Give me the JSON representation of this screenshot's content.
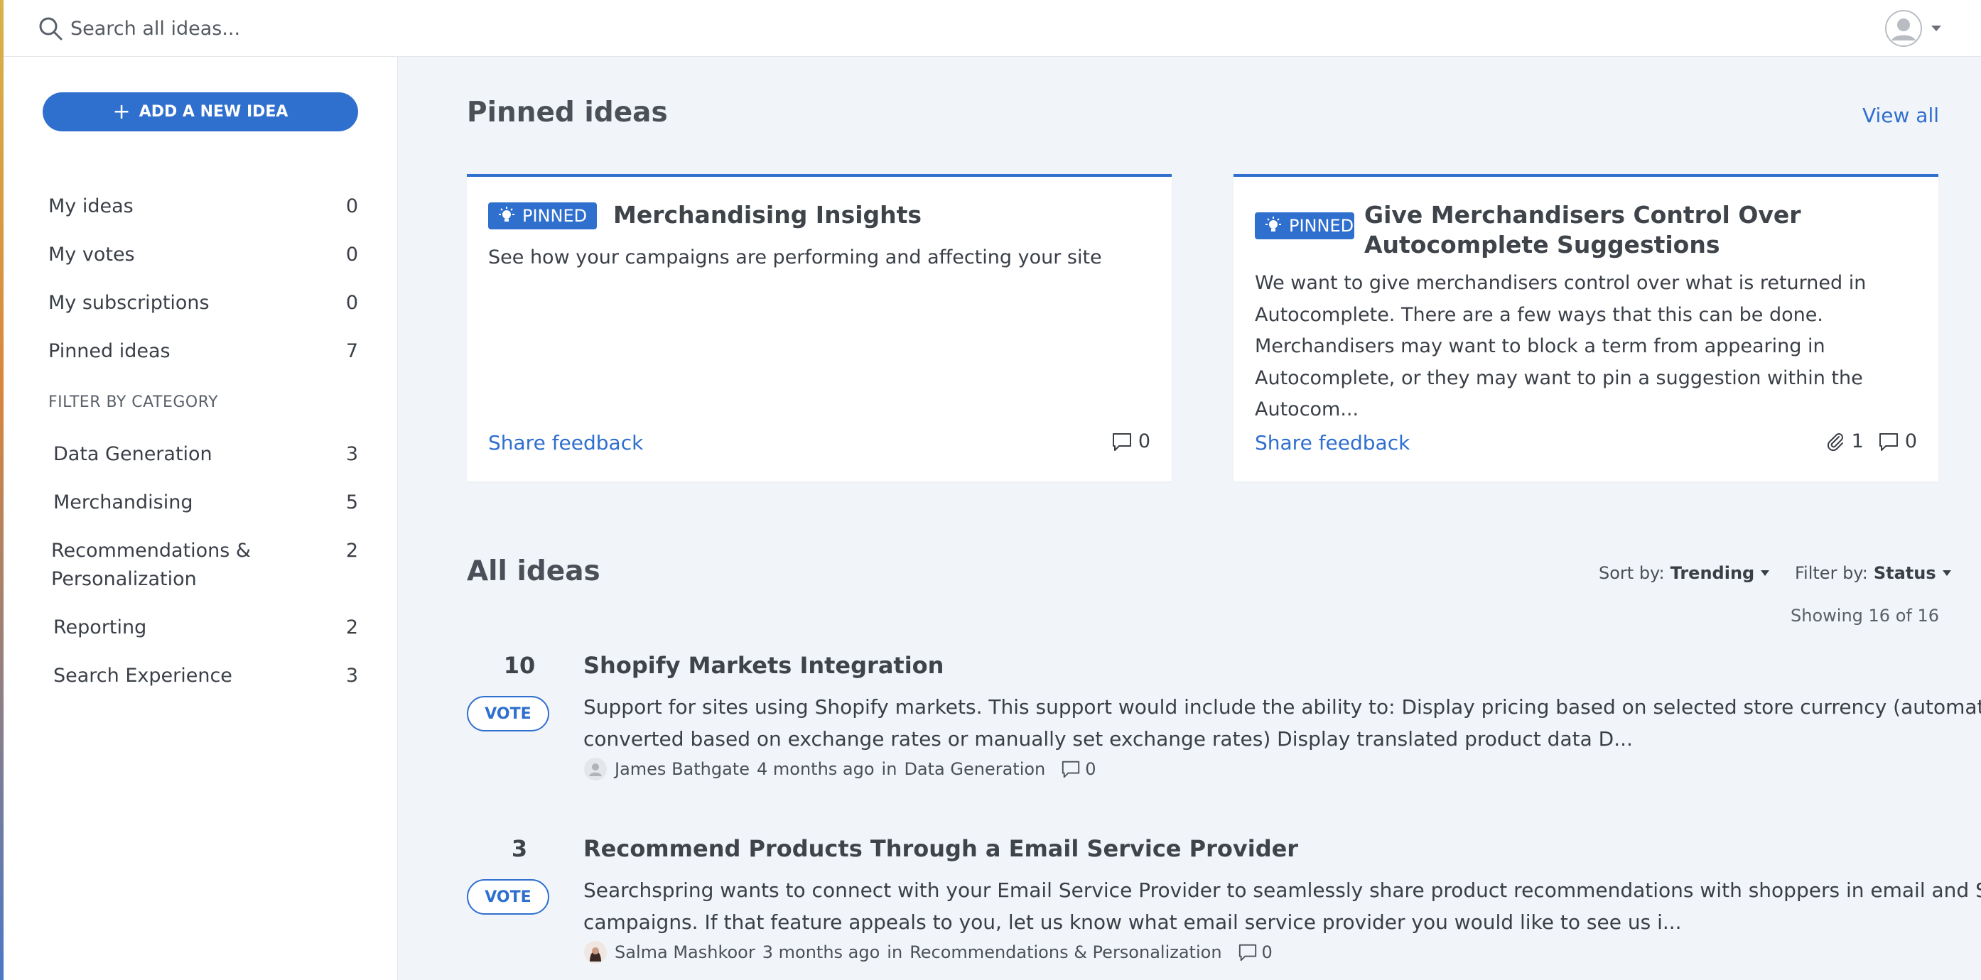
{
  "search": {
    "placeholder": "Search all ideas..."
  },
  "sidebar": {
    "add_button_label": "ADD A NEW IDEA",
    "nav": [
      {
        "label": "My ideas",
        "count": "0"
      },
      {
        "label": "My votes",
        "count": "0"
      },
      {
        "label": "My subscriptions",
        "count": "0"
      },
      {
        "label": "Pinned ideas",
        "count": "7"
      }
    ],
    "filter_heading": "FILTER BY CATEGORY",
    "categories": [
      {
        "label": "Data Generation",
        "count": "3"
      },
      {
        "label": "Merchandising",
        "count": "5"
      },
      {
        "label": "Recommendations & Personalization",
        "count": "2"
      },
      {
        "label": "Reporting",
        "count": "2"
      },
      {
        "label": "Search Experience",
        "count": "3"
      }
    ]
  },
  "pinned": {
    "title": "Pinned ideas",
    "view_all": "View all",
    "badge": "PINNED",
    "cards": [
      {
        "title": "Merchandising Insights",
        "description": "See how your campaigns are performing and affecting your site",
        "share": "Share feedback",
        "comments": "0"
      },
      {
        "title": "Give Merchandisers Control Over Autocomplete Suggestions",
        "description": "We want to give merchandisers control over what is returned in Autocomplete. There are a few ways that this can be done. Merchandisers may want to block a term from appearing in Autocomplete, or they may want to pin a suggestion within the Autocom...",
        "share": "Share feedback",
        "attachments": "1",
        "comments": "0"
      }
    ]
  },
  "all_ideas": {
    "title": "All ideas",
    "sort_label": "Sort by:",
    "sort_value": "Trending",
    "filter_label": "Filter by:",
    "filter_value": "Status",
    "showing": "Showing 16 of 16",
    "vote_label": "VOTE",
    "items": [
      {
        "votes": "10",
        "title": "Shopify Markets Integration",
        "description": "Support for sites using Shopify markets. This support would include the ability to: Display pricing based on selected store currency (automatically converted based on exchange rates or manually set exchange rates) Display translated product data D...",
        "author": "James Bathgate",
        "time": "4 months ago",
        "in": "in",
        "category": "Data Generation",
        "comments": "0"
      },
      {
        "votes": "3",
        "title": "Recommend Products Through a Email Service Provider",
        "description": "Searchspring wants to connect with your Email Service Provider to seamlessly share product recommendations with shoppers in email and SMS campaigns. If that feature appeals to you, let us know what email service provider you would like to see us i...",
        "author": "Salma Mashkoor",
        "time": "3 months ago",
        "in": "in",
        "category": "Recommendations & Personalization",
        "comments": "0"
      }
    ]
  },
  "colors": {
    "accent": "#2f6fce",
    "background": "#f1f4f9",
    "surface": "#ffffff"
  }
}
